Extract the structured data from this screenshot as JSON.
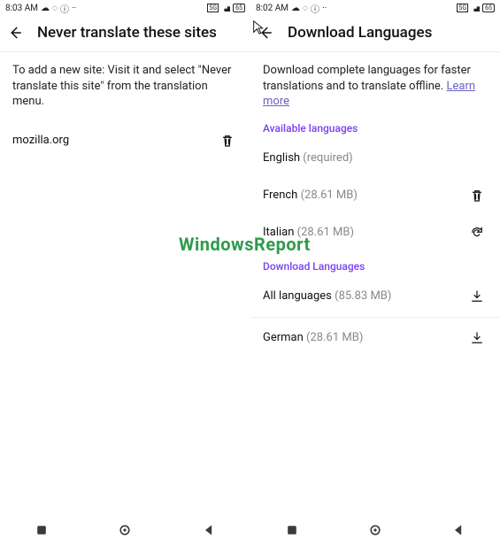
{
  "watermark": "WindowsReport",
  "left": {
    "statusbar": {
      "time": "8:03 AM",
      "battery": "65"
    },
    "header": {
      "title": "Never translate these sites"
    },
    "help": "To add a new site: Visit it and select \"Never translate this site\" from the translation menu.",
    "sites": [
      {
        "domain": "mozilla.org"
      }
    ]
  },
  "right": {
    "statusbar": {
      "time": "8:02 AM",
      "battery": "65"
    },
    "header": {
      "title": "Download Languages"
    },
    "help_prefix": "Download complete languages for faster translations and to translate offline. ",
    "learn_more": "Learn more",
    "sections": {
      "available_label": "Available languages",
      "download_label": "Download Languages"
    },
    "available": [
      {
        "name": "English",
        "meta": "(required)",
        "action": "none"
      },
      {
        "name": "French",
        "meta": "(28.61 MB)",
        "action": "delete"
      },
      {
        "name": "Italian",
        "meta": "(28.61 MB)",
        "action": "refresh"
      }
    ],
    "downloadable": [
      {
        "name": "All languages",
        "meta": "(85.83 MB)",
        "action": "download"
      },
      {
        "name": "German",
        "meta": "(28.61 MB)",
        "action": "download"
      }
    ]
  }
}
